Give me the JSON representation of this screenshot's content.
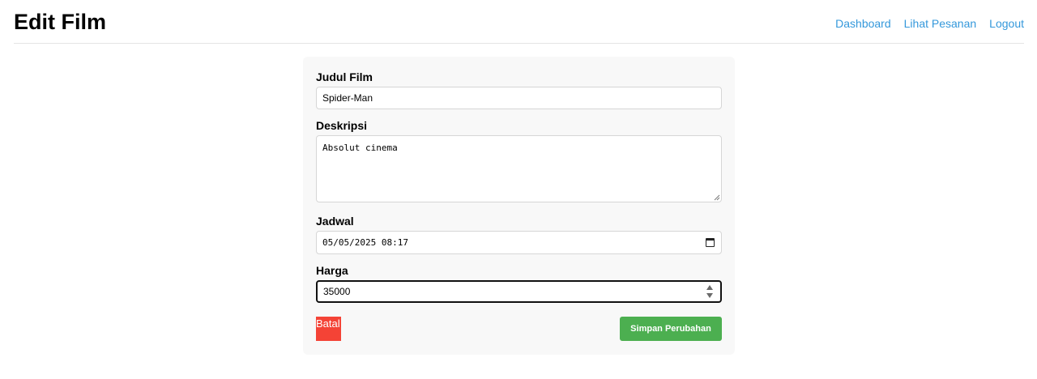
{
  "header": {
    "title": "Edit Film",
    "nav": [
      {
        "label": "Dashboard"
      },
      {
        "label": "Lihat Pesanan"
      },
      {
        "label": "Logout"
      }
    ]
  },
  "form": {
    "title_label": "Judul Film",
    "title_value": "Spider-Man",
    "description_label": "Deskripsi",
    "description_value": "Absolut cinema",
    "schedule_label": "Jadwal",
    "schedule_value": "05/05/2025 08:17",
    "price_label": "Harga",
    "price_value": "35000",
    "cancel_label": "Batal",
    "save_label": "Simpan Perubahan"
  },
  "colors": {
    "link": "#3498db",
    "cancel": "#f44336",
    "save": "#4caf50",
    "card": "#f8f8f8"
  },
  "icons": [
    "calendar-icon",
    "spinner-arrows-icon",
    "resize-grip-icon"
  ]
}
